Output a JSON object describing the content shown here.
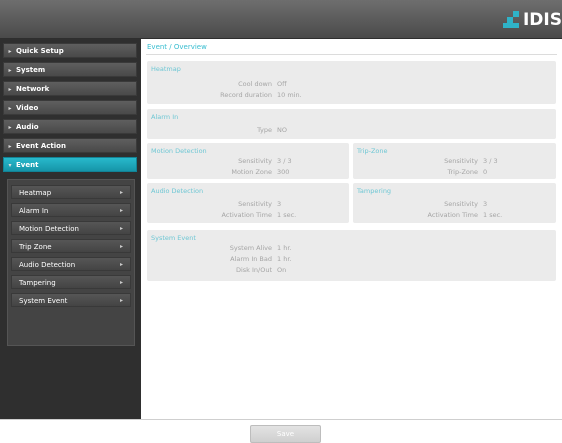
{
  "header": {
    "logo_text": "IDIS"
  },
  "sidebar": {
    "menu": [
      {
        "label": "Quick Setup"
      },
      {
        "label": "System"
      },
      {
        "label": "Network"
      },
      {
        "label": "Video"
      },
      {
        "label": "Audio"
      },
      {
        "label": "Event Action"
      },
      {
        "label": "Event",
        "active": true
      }
    ],
    "submenu": [
      {
        "label": "Heatmap"
      },
      {
        "label": "Alarm In"
      },
      {
        "label": "Motion Detection"
      },
      {
        "label": "Trip Zone"
      },
      {
        "label": "Audio Detection"
      },
      {
        "label": "Tampering"
      },
      {
        "label": "System Event"
      }
    ]
  },
  "main": {
    "breadcrumb": "Event / Overview",
    "heatmap": {
      "title": "Heatmap",
      "rows": [
        {
          "label": "Cool down",
          "value": "Off"
        },
        {
          "label": "Record duration",
          "value": "10 min."
        }
      ]
    },
    "alarm_in": {
      "title": "Alarm In",
      "rows": [
        {
          "label": "Type",
          "value": "NO"
        }
      ]
    },
    "motion_detection": {
      "title": "Motion Detection",
      "rows": [
        {
          "label": "Sensitivity",
          "value": "3 / 3"
        },
        {
          "label": "Motion Zone",
          "value": "300"
        }
      ]
    },
    "trip_zone": {
      "title": "Trip-Zone",
      "rows": [
        {
          "label": "Sensitivity",
          "value": "3 / 3"
        },
        {
          "label": "Trip-Zone",
          "value": "0"
        }
      ]
    },
    "audio_detection": {
      "title": "Audio Detection",
      "rows": [
        {
          "label": "Sensitivity",
          "value": "3"
        },
        {
          "label": "Activation Time",
          "value": "1 sec."
        }
      ]
    },
    "tampering": {
      "title": "Tampering",
      "rows": [
        {
          "label": "Sensitivity",
          "value": "3"
        },
        {
          "label": "Activation Time",
          "value": "1 sec."
        }
      ]
    },
    "system_event": {
      "title": "System Event",
      "rows": [
        {
          "label": "System Alive",
          "value": "1 hr."
        },
        {
          "label": "Alarm In Bad",
          "value": "1 hr."
        },
        {
          "label": "Disk In/Out",
          "value": "On"
        }
      ]
    }
  },
  "footer": {
    "save_label": "Save"
  },
  "colors": {
    "accent": "#1fa8bc",
    "panel": "#ebebeb",
    "sidebar": "#2f2f2f"
  }
}
